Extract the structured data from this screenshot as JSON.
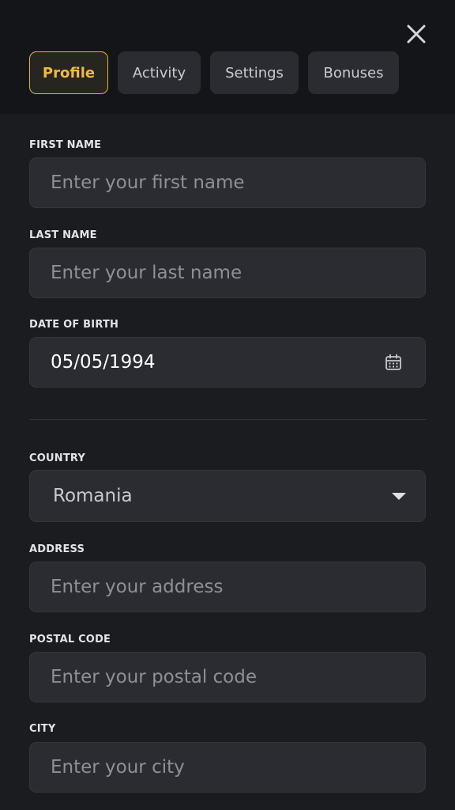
{
  "tabs": [
    {
      "label": "Profile",
      "active": true
    },
    {
      "label": "Activity",
      "active": false
    },
    {
      "label": "Settings",
      "active": false
    },
    {
      "label": "Bonuses",
      "active": false
    }
  ],
  "form": {
    "first_name": {
      "label": "FIRST NAME",
      "placeholder": "Enter your first name",
      "value": ""
    },
    "last_name": {
      "label": "LAST NAME",
      "placeholder": "Enter your last name",
      "value": ""
    },
    "date_of_birth": {
      "label": "DATE OF BIRTH",
      "value": "05/05/1994",
      "icon": "calendar-icon"
    },
    "country": {
      "label": "COUNTRY",
      "value": "Romania",
      "icon": "caret-down-icon"
    },
    "address": {
      "label": "ADDRESS",
      "placeholder": "Enter your address",
      "value": ""
    },
    "postal_code": {
      "label": "POSTAL CODE",
      "placeholder": "Enter your postal code",
      "value": ""
    },
    "city": {
      "label": "CITY",
      "placeholder": "Enter your city",
      "value": ""
    }
  },
  "colors": {
    "accent": "#f0b943",
    "background": "#1b1c20",
    "header_background": "#141518",
    "field_background": "#2a2c32"
  },
  "icons": {
    "close": "close-icon"
  }
}
